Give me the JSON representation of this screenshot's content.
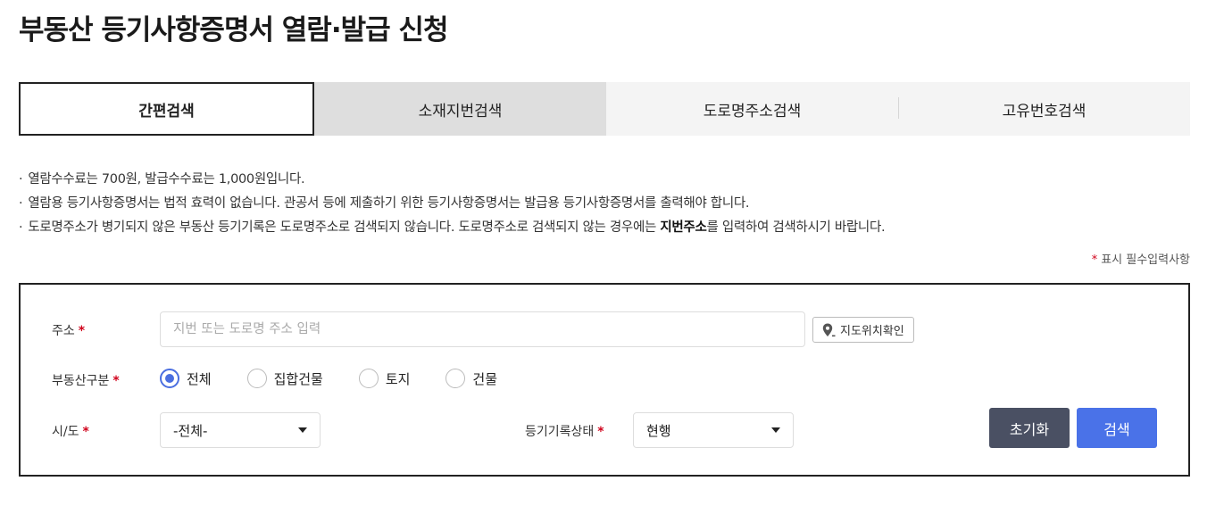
{
  "page": {
    "title": "부동산 등기사항증명서 열람·발급 신청"
  },
  "tabs": [
    {
      "label": "간편검색",
      "active": true
    },
    {
      "label": "소재지번검색",
      "active": false
    },
    {
      "label": "도로명주소검색",
      "active": false
    },
    {
      "label": "고유번호검색",
      "active": false
    }
  ],
  "notices": {
    "bullet": "·",
    "line1": "열람수수료는  700원, 발급수수료는  1,000원입니다.",
    "line2": "열람용 등기사항증명서는 법적 효력이 없습니다. 관공서 등에 제출하기 위한 등기사항증명서는 발급용 등기사항증명서를 출력해야 합니다.",
    "line3_pre": "도로명주소가 병기되지 않은 부동산 등기기록은 도로명주소로 검색되지 않습니다. 도로명주소로 검색되지 않는 경우에는 ",
    "line3_bold": "지번주소",
    "line3_post": "를 입력하여 검색하시기 바랍니다."
  },
  "required_note": {
    "star": "*",
    "text": "표시 필수입력사항"
  },
  "form": {
    "required_mark": "*",
    "address": {
      "label": "주소",
      "placeholder": "지번 또는 도로명 주소 입력",
      "value": ""
    },
    "map_button": {
      "label": "지도위치확인",
      "icon": "map-pin-icon"
    },
    "property_type": {
      "label": "부동산구분",
      "options": [
        "전체",
        "집합건물",
        "토지",
        "건물"
      ],
      "selected": "전체"
    },
    "sido": {
      "label": "시/도",
      "value": "-전체-"
    },
    "record_status": {
      "label": "등기기록상태",
      "value": "현행"
    },
    "reset_button": "초기화",
    "search_button": "검색"
  },
  "colors": {
    "accent": "#4a72e8",
    "reset": "#4a5063",
    "required": "#d0021b",
    "radio_checked": "#4a6ee0"
  }
}
